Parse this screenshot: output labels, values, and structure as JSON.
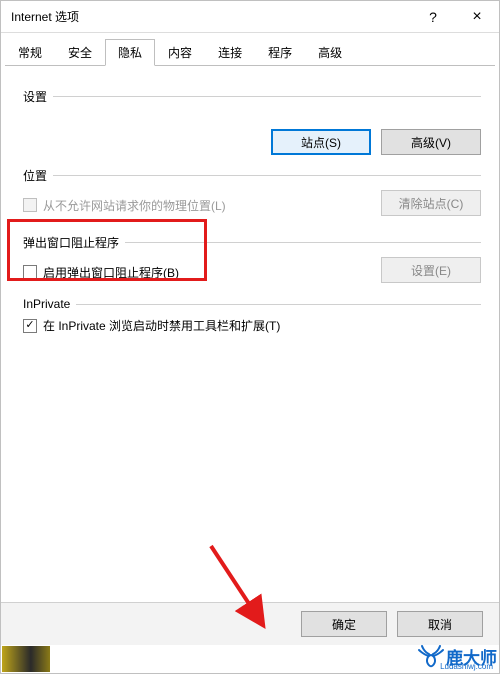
{
  "window": {
    "title": "Internet 选项",
    "help_symbol": "?",
    "close_symbol": "×"
  },
  "tabs": [
    {
      "label": "常规",
      "active": false
    },
    {
      "label": "安全",
      "active": false
    },
    {
      "label": "隐私",
      "active": true
    },
    {
      "label": "内容",
      "active": false
    },
    {
      "label": "连接",
      "active": false
    },
    {
      "label": "程序",
      "active": false
    },
    {
      "label": "高级",
      "active": false
    }
  ],
  "sections": {
    "settings": {
      "title": "设置",
      "sites_btn": "站点(S)",
      "advanced_btn": "高级(V)"
    },
    "location": {
      "title": "位置",
      "never_allow_label": "从不允许网站请求你的物理位置(L)",
      "never_allow_checked": false,
      "clear_sites_btn": "清除站点(C)"
    },
    "popup": {
      "title": "弹出窗口阻止程序",
      "enable_label": "启用弹出窗口阻止程序(B)",
      "enable_checked": false,
      "settings_btn": "设置(E)"
    },
    "inprivate": {
      "title": "InPrivate",
      "disable_ext_label": "在 InPrivate 浏览启动时禁用工具栏和扩展(T)",
      "disable_ext_checked": true
    }
  },
  "footer": {
    "ok": "确定",
    "cancel": "取消"
  },
  "watermark": {
    "brand": "鹿大师",
    "site": "Ludashiwj.com"
  }
}
